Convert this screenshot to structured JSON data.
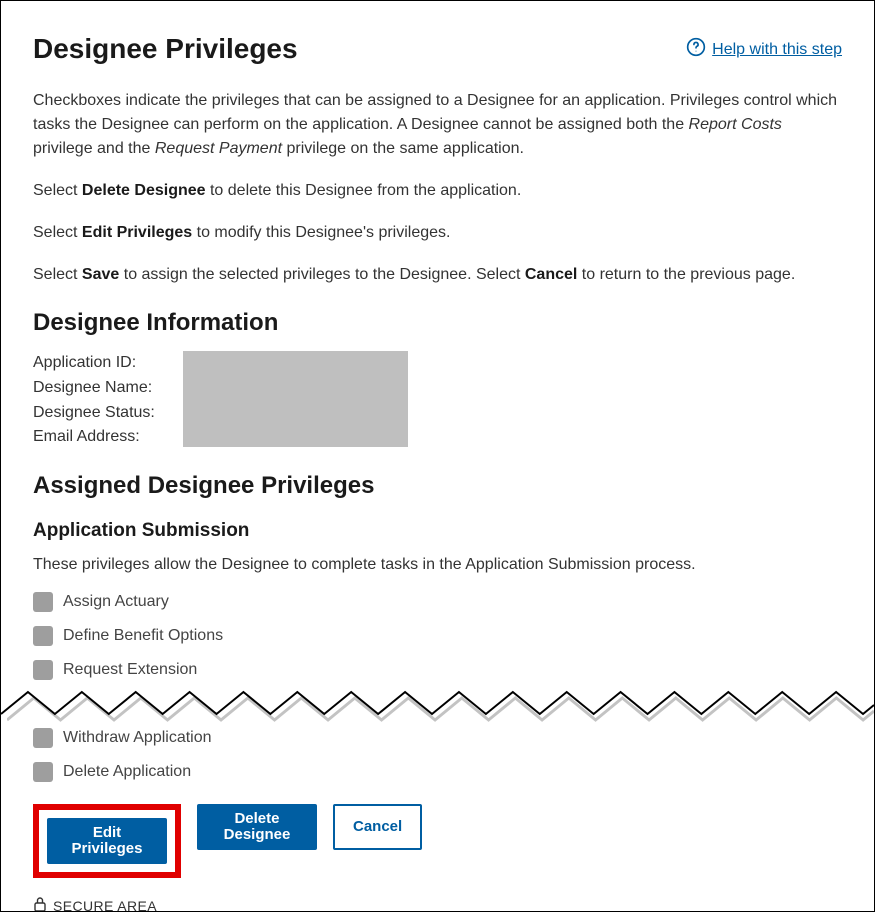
{
  "header": {
    "title": "Designee Privileges",
    "help_label": "Help with this step"
  },
  "intro": {
    "p1_a": "Checkboxes indicate the privileges that can be assigned to a Designee for an application. Privileges control which tasks the Designee can perform on the application. A Designee cannot be assigned both the ",
    "p1_em1": "Report Costs",
    "p1_b": " privilege and the ",
    "p1_em2": "Request Payment",
    "p1_c": " privilege on the same application.",
    "p2_a": "Select ",
    "p2_bold": "Delete Designee",
    "p2_b": " to delete this Designee from the application.",
    "p3_a": "Select ",
    "p3_bold": "Edit Privileges",
    "p3_b": " to modify this Designee's privileges.",
    "p4_a": "Select ",
    "p4_bold1": "Save",
    "p4_b": " to assign the selected privileges to the Designee. Select ",
    "p4_bold2": "Cancel",
    "p4_c": " to return to the previous page."
  },
  "designee_info": {
    "heading": "Designee Information",
    "labels": {
      "application_id": "Application ID:",
      "designee_name": "Designee Name:",
      "designee_status": "Designee Status:",
      "email_address": "Email Address:"
    }
  },
  "assigned": {
    "heading": "Assigned Designee Privileges",
    "subsection": {
      "title": "Application Submission",
      "desc": "These privileges allow the Designee to complete tasks in the Application Submission process.",
      "items_top": [
        "Assign Actuary",
        "Define Benefit Options",
        "Request Extension"
      ],
      "items_bottom": [
        "Withdraw Application",
        "Delete Application"
      ]
    }
  },
  "buttons": {
    "edit": "Edit\nPrivileges",
    "delete": "Delete\nDesignee",
    "cancel": "Cancel"
  },
  "footer": {
    "secure": "SECURE AREA"
  }
}
